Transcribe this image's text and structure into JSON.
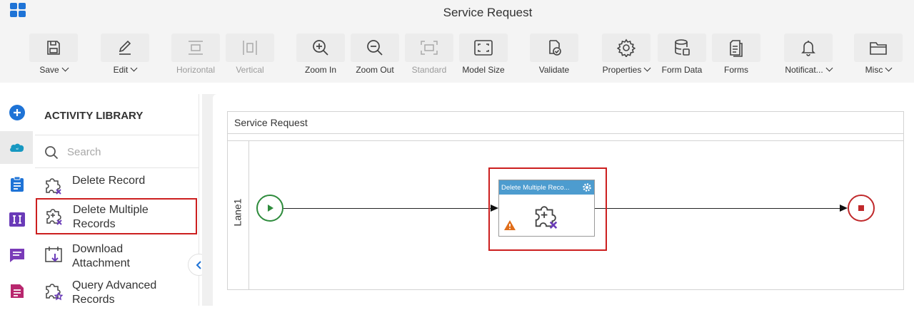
{
  "window": {
    "title": "Service Request"
  },
  "toolbar": {
    "save": "Save",
    "edit": "Edit",
    "horizontal": "Horizontal",
    "vertical": "Vertical",
    "zoom_in": "Zoom In",
    "zoom_out": "Zoom Out",
    "standard": "Standard",
    "model_size": "Model Size",
    "validate": "Validate",
    "properties": "Properties",
    "form_data": "Form Data",
    "forms": "Forms",
    "notifications": "Notificat...",
    "misc": "Misc"
  },
  "rail": {
    "items": [
      {
        "icon": "add-circle-icon"
      },
      {
        "icon": "salesforce-icon",
        "active": true
      },
      {
        "icon": "clipboard-icon"
      },
      {
        "icon": "text-field-icon"
      },
      {
        "icon": "chat-icon"
      },
      {
        "icon": "document-icon"
      }
    ]
  },
  "library": {
    "title": "ACTIVITY LIBRARY",
    "search_placeholder": "Search",
    "items": [
      {
        "label": "Delete Record",
        "icon": "delete-record-icon"
      },
      {
        "label_line1": "Delete Multiple",
        "label_line2": "Records",
        "icon": "delete-multiple-records-icon",
        "selected": true
      },
      {
        "label_line1": "Download",
        "label_line2": "Attachment",
        "icon": "download-attachment-icon"
      },
      {
        "label_line1": "Query Advanced",
        "label_line2": "Records",
        "icon": "query-advanced-records-icon"
      }
    ]
  },
  "canvas": {
    "pool_title": "Service Request",
    "lane_label": "Lane1",
    "task_label": "Delete Multiple Reco...",
    "colors": {
      "task_header": "#4d9ccf",
      "start": "#2e8b3c",
      "end": "#c0292b",
      "highlight": "#cc1f1f"
    }
  }
}
